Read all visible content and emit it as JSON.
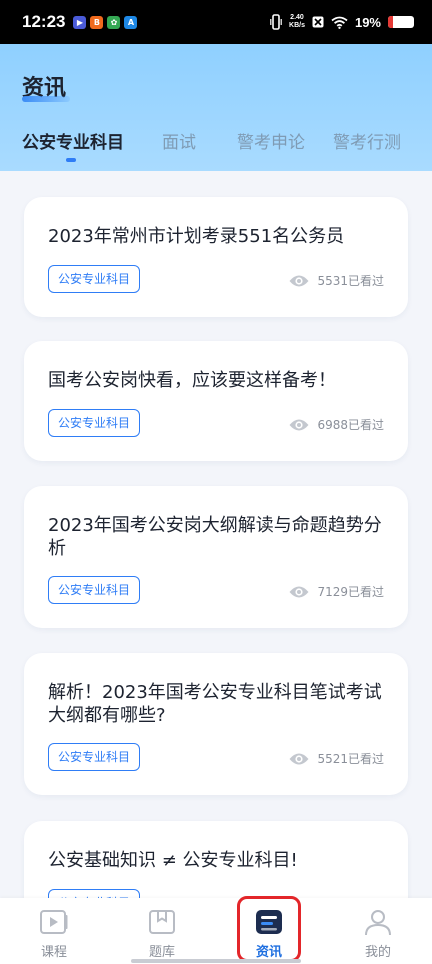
{
  "status_bar": {
    "time": "12:23",
    "apps": [
      {
        "icon": "video-app-icon",
        "color": "#4a5bd8",
        "glyph": "▶"
      },
      {
        "icon": "orange-app-icon",
        "color": "#f06a1d",
        "glyph": "B"
      },
      {
        "icon": "photos-app-icon",
        "color": "#34a853",
        "glyph": "✿"
      },
      {
        "icon": "blue-app-icon",
        "color": "#1e88e5",
        "glyph": "A"
      }
    ],
    "net_speed_value": "2.40",
    "net_speed_unit": "KB/s",
    "battery": "19%",
    "battery_level": 0.19
  },
  "header": {
    "title": "资讯",
    "tabs": [
      {
        "label": "公安专业科目",
        "active": true
      },
      {
        "label": "面试",
        "active": false
      },
      {
        "label": "警考申论",
        "active": false
      },
      {
        "label": "警考行测",
        "active": false
      }
    ]
  },
  "articles": [
    {
      "title": "2023年常州市计划考录551名公务员",
      "tag": "公安专业科目",
      "views": "5531已看过"
    },
    {
      "title": "国考公安岗快看，应该要这样备考！",
      "tag": "公安专业科目",
      "views": "6988已看过"
    },
    {
      "title": "2023年国考公安岗大纲解读与命题趋势分析",
      "tag": "公安专业科目",
      "views": "7129已看过"
    },
    {
      "title": "解析！2023年国考公安专业科目笔试考试大纲都有哪些?",
      "tag": "公安专业科目",
      "views": "5521已看过"
    },
    {
      "title": "公安基础知识 ≠ 公安专业科目!",
      "tag": "公安专业科目",
      "views": ""
    }
  ],
  "bottom_nav": [
    {
      "label": "课程",
      "icon": "play-course-icon",
      "active": false
    },
    {
      "label": "题库",
      "icon": "question-bank-icon",
      "active": false
    },
    {
      "label": "资讯",
      "icon": "news-icon",
      "active": true
    },
    {
      "label": "我的",
      "icon": "profile-icon",
      "active": false
    }
  ],
  "colors": {
    "accent": "#2f7df6",
    "highlight": "#e3262a"
  }
}
